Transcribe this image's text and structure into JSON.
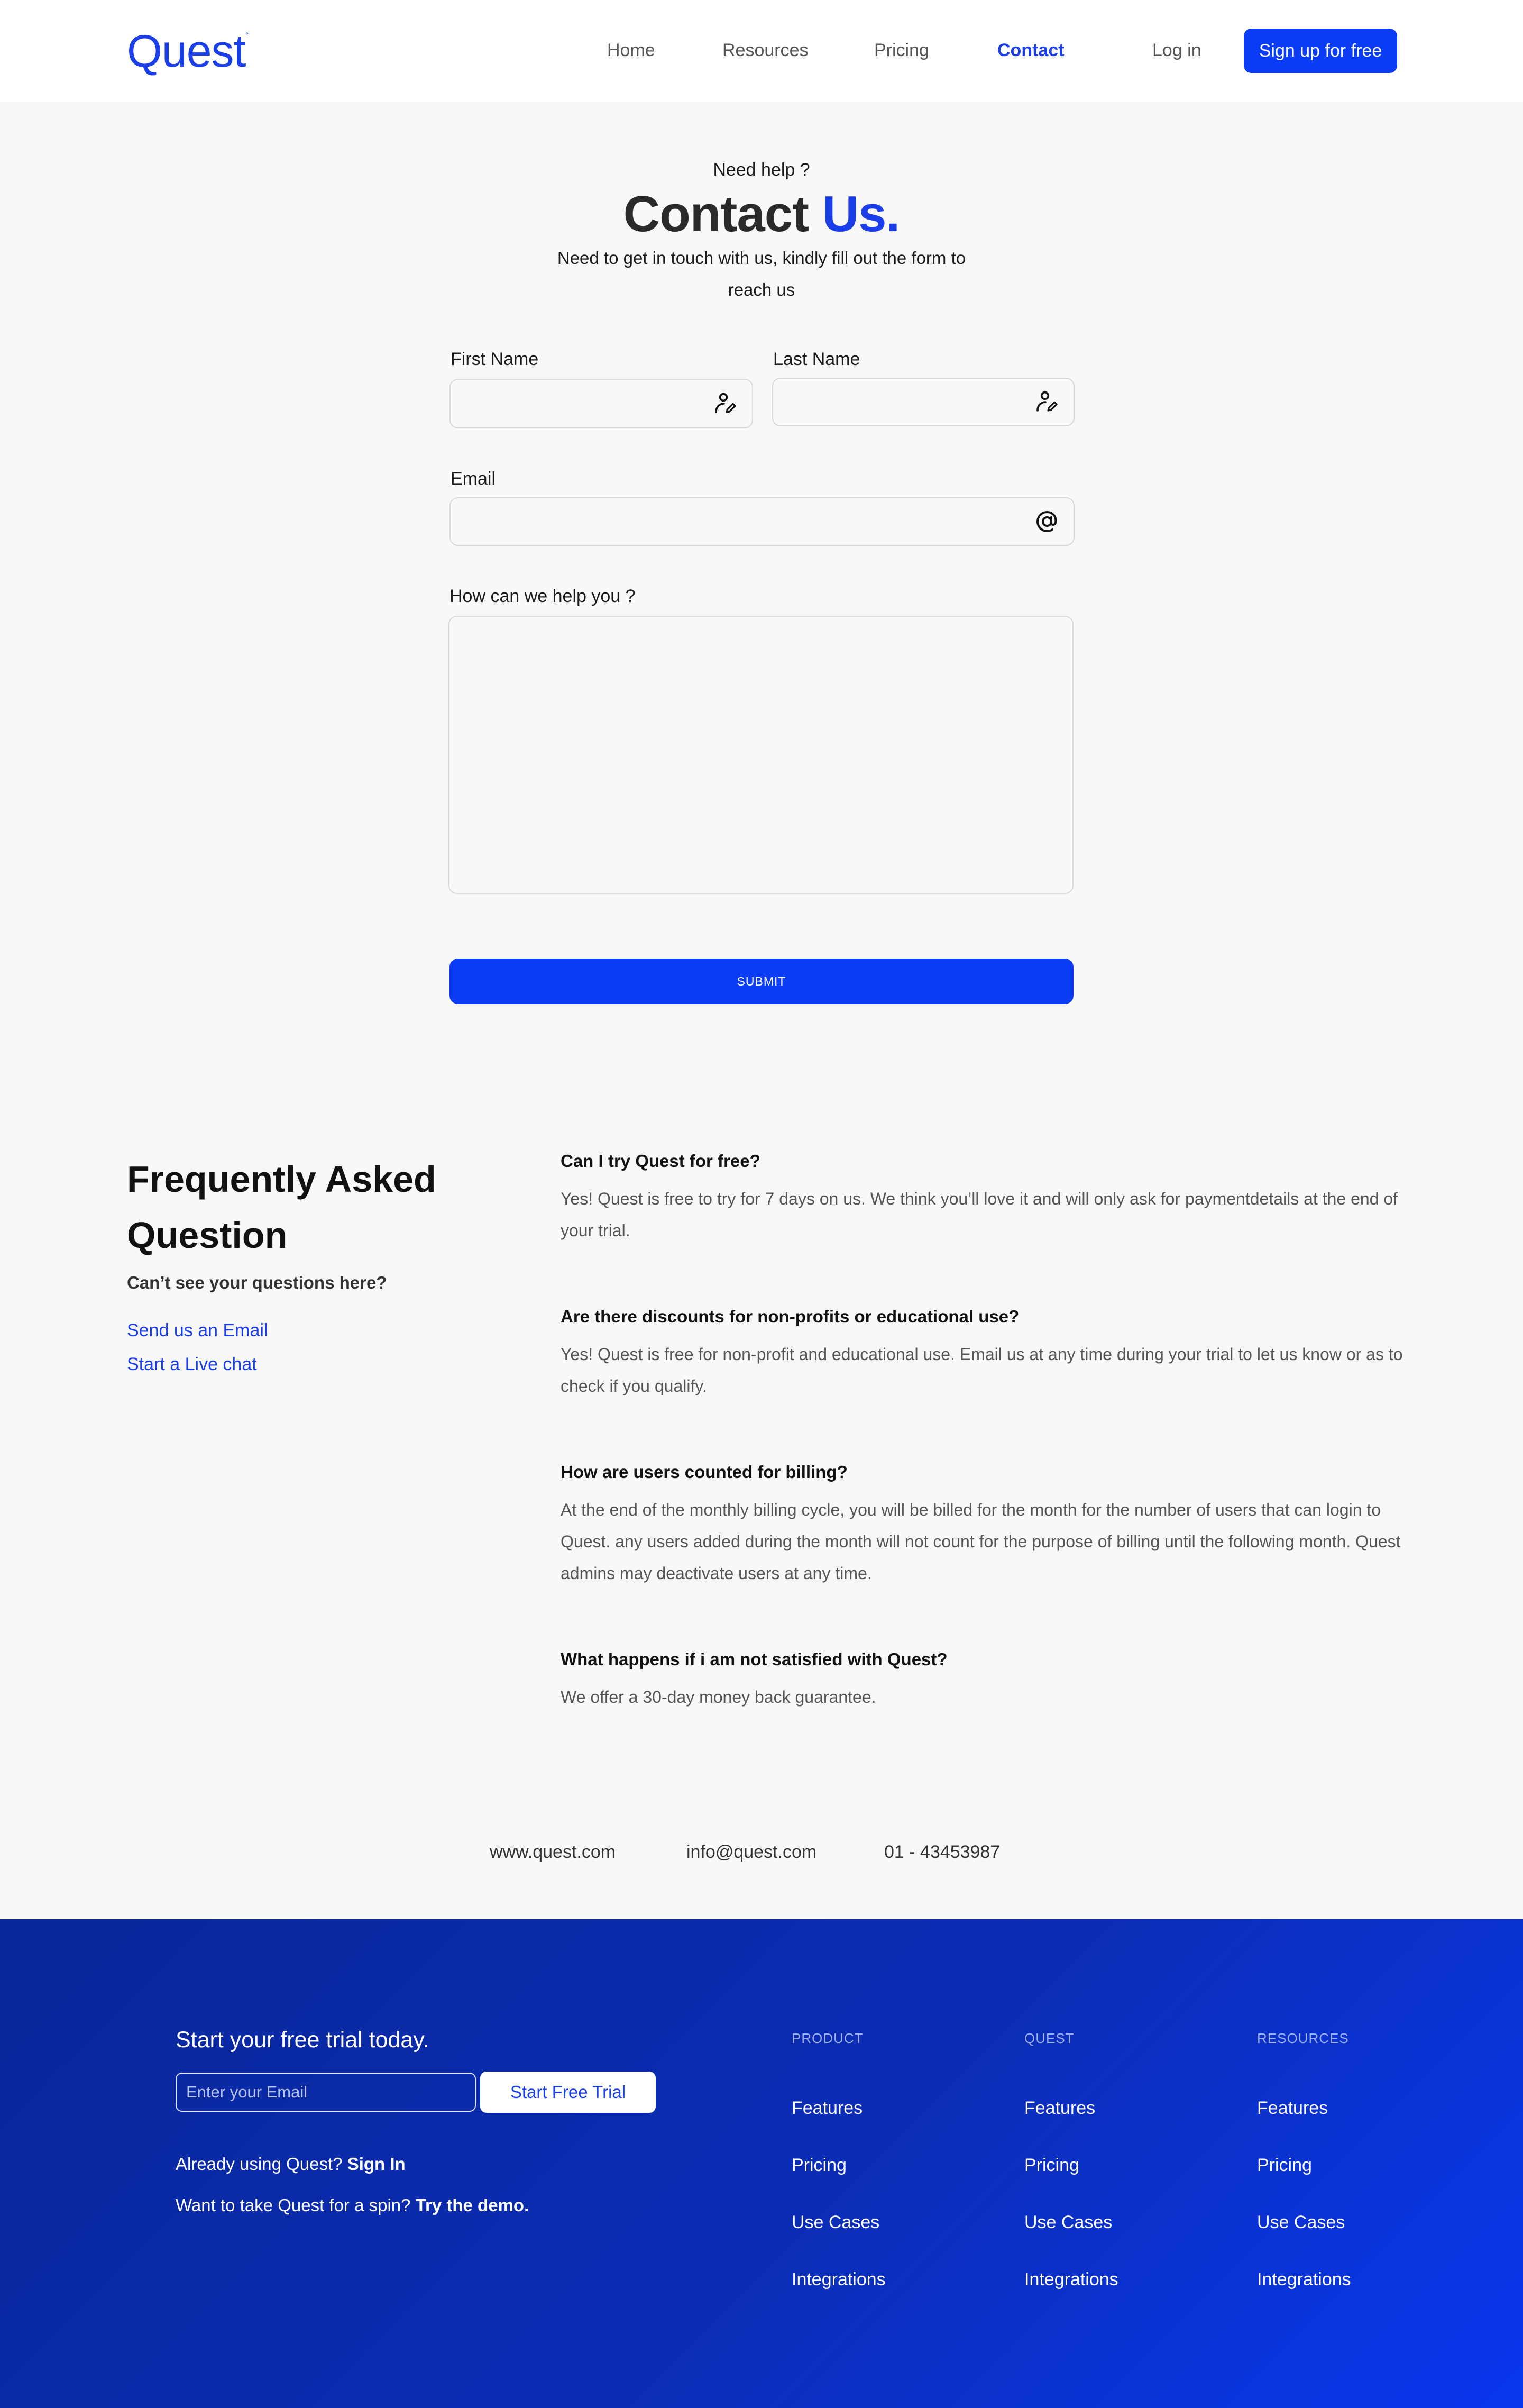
{
  "header": {
    "logo": "Quest",
    "nav": [
      "Home",
      "Resources",
      "Pricing",
      "Contact"
    ],
    "active": "Contact",
    "login": "Log in",
    "signup": "Sign up for free"
  },
  "hero": {
    "kicker": "Need help ?",
    "title_main": "Contact",
    "title_accent": "Us.",
    "subtitle": "Need to get in touch with us, kindly fill out the form to reach us"
  },
  "form": {
    "first_name_label": "First Name",
    "last_name_label": "Last Name",
    "email_label": "Email",
    "message_label": "How can we help you ?",
    "submit": "SUBMIT"
  },
  "faq": {
    "title": "Frequently Asked Question",
    "subtitle": "Can’t see your questions here?",
    "links": [
      "Send us an Email",
      "Start a Live chat"
    ],
    "items": [
      {
        "q": "Can I try Quest for free?",
        "a": "Yes! Quest is free to try for 7 days on us. We think you’ll love it and will  only ask for paymentdetails at the end of your trial."
      },
      {
        "q": "Are there discounts for non-profits or educational use?",
        "a": "Yes! Quest is free for non-profit and educational use. Email us at any time during your trial to let us know or as to check if you qualify."
      },
      {
        "q": "How are users  counted for billing?",
        "a": "At the end of the monthly billing cycle, you will be billed for the month for the number of users that can login to Quest. any users added during the month will not count for the purpose of billing until the following month. Quest admins may deactivate users at any time."
      },
      {
        "q": "What happens if i am not satisfied with Quest?",
        "a": "We offer a 30-day money back guarantee."
      }
    ]
  },
  "contact_info": {
    "website": "www.quest.com",
    "email": "info@quest.com",
    "phone": "01 - 43453987"
  },
  "footer": {
    "heading": "Start your free trial today.",
    "email_placeholder": "Enter your Email",
    "trial_button": "Start Free Trial",
    "signin_prefix": "Already using Quest?",
    "signin_link": "Sign In",
    "demo_prefix": "Want to take Quest for a spin?",
    "demo_link": "Try the demo.",
    "columns": [
      {
        "title": "PRODUCT",
        "links": [
          "Features",
          "Pricing",
          "Use Cases",
          "Integrations"
        ]
      },
      {
        "title": "QUEST",
        "links": [
          "Features",
          "Pricing",
          "Use Cases",
          "Integrations"
        ]
      },
      {
        "title": "RESOURCES",
        "links": [
          "Features",
          "Pricing",
          "Use Cases",
          "Integrations"
        ]
      }
    ]
  },
  "colors": {
    "accent": "#1a3fe8",
    "button": "#0a3cf5",
    "background": "#f8f8f8",
    "footer_start": "#0a2799",
    "footer_end": "#0937ee"
  },
  "icons": {
    "name_fields": "user-edit-icon",
    "email_field": "at-sign-icon"
  }
}
